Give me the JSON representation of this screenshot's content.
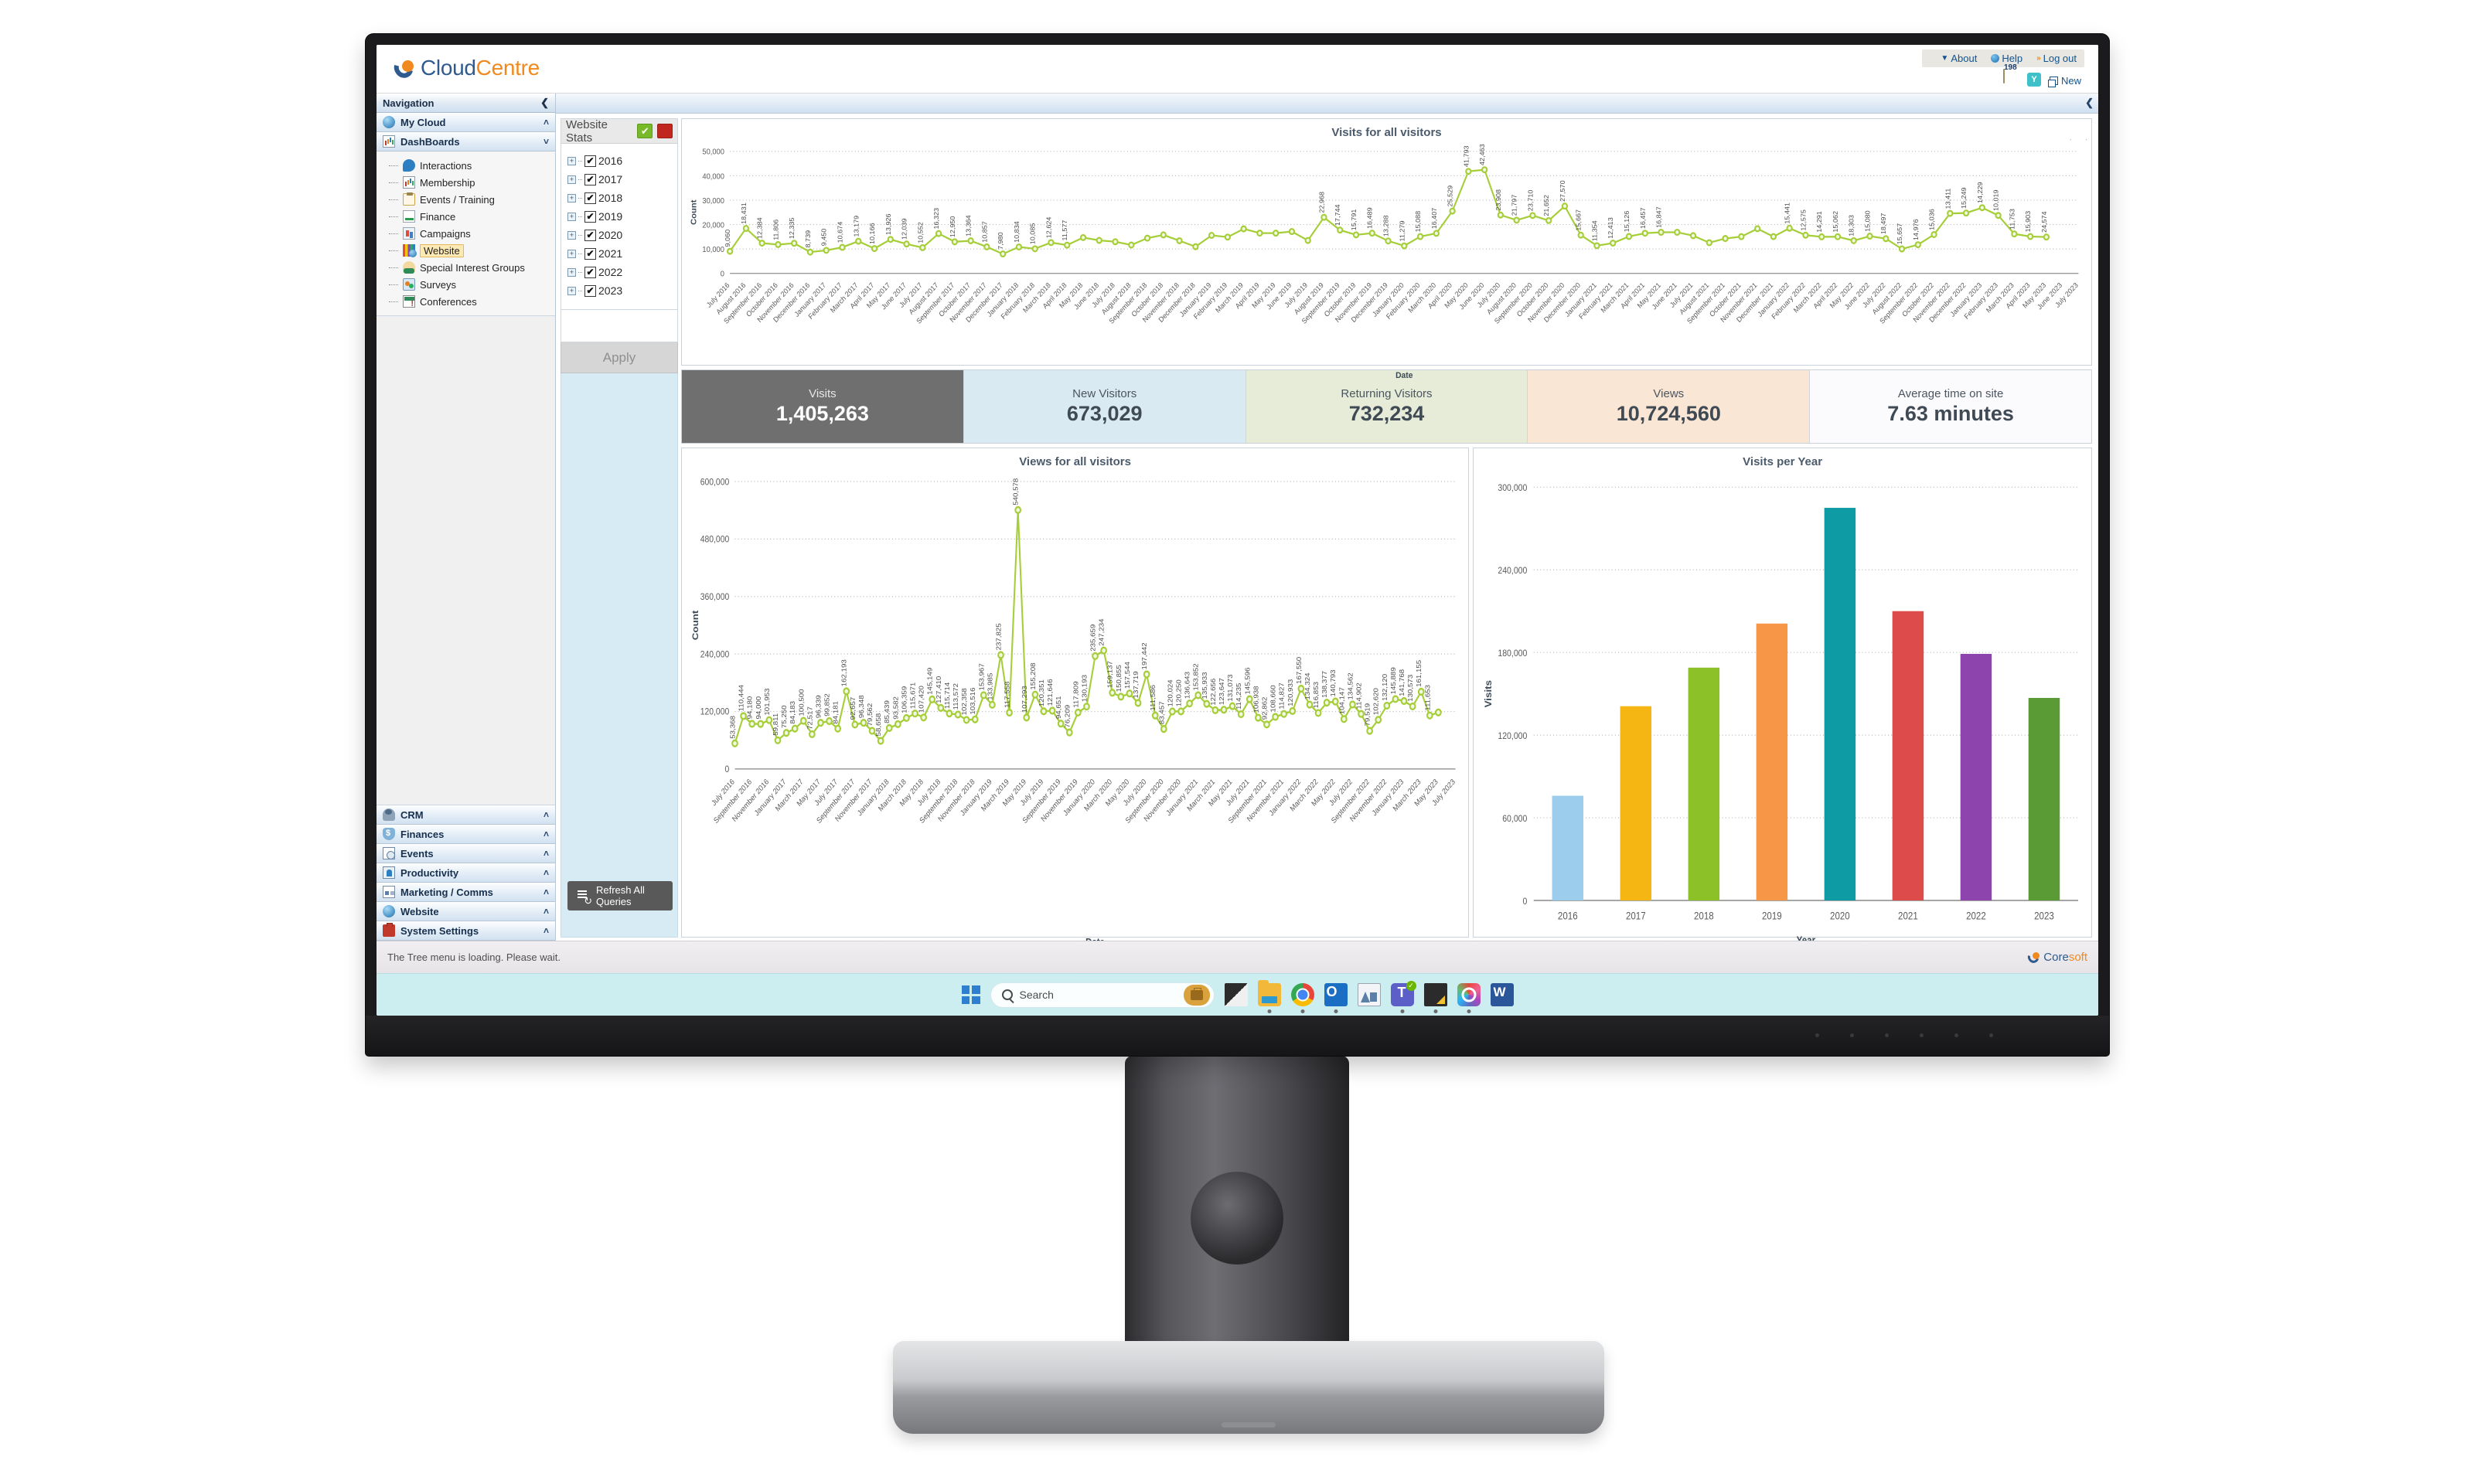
{
  "app": {
    "brand_first": "Cloud",
    "brand_second": "Centre",
    "status_text": "The Tree menu is loading. Please wait.",
    "footer_brand_first": "Core",
    "footer_brand_second": "soft"
  },
  "header": {
    "links": [
      {
        "label": "About",
        "icon": "caret-down-icon"
      },
      {
        "label": "Help",
        "icon": "globe-icon"
      },
      {
        "label": "Log out",
        "icon": "double-chevron-icon"
      }
    ],
    "note_badge": "198",
    "teal_icon_label": "Y",
    "new_label": "New"
  },
  "sidebar": {
    "nav_title": "Navigation",
    "sections_top": [
      {
        "label": "My Cloud",
        "icon": "cloud-icon",
        "chevron": "˄"
      },
      {
        "label": "DashBoards",
        "icon": "bar-chart-icon",
        "chevron": "˅"
      }
    ],
    "tree_items": [
      {
        "label": "Interactions",
        "icon": "chat-bubble-icon",
        "selected": false
      },
      {
        "label": "Membership",
        "icon": "bar-chart-icon",
        "selected": false
      },
      {
        "label": "Events / Training",
        "icon": "clipboard-icon",
        "selected": false
      },
      {
        "label": "Finance",
        "icon": "document-icon",
        "selected": false
      },
      {
        "label": "Campaigns",
        "icon": "campaign-chart-icon",
        "selected": false
      },
      {
        "label": "Website",
        "icon": "website-chart-icon",
        "selected": true
      },
      {
        "label": "Special Interest Groups",
        "icon": "people-group-icon",
        "selected": false
      },
      {
        "label": "Surveys",
        "icon": "survey-icon",
        "selected": false
      },
      {
        "label": "Conferences",
        "icon": "conference-icon",
        "selected": false
      }
    ],
    "sections_bottom": [
      {
        "label": "CRM",
        "icon": "person-icon",
        "chevron": "˄"
      },
      {
        "label": "Finances",
        "icon": "money-bag-icon",
        "chevron": "˄"
      },
      {
        "label": "Events",
        "icon": "calendar-clock-icon",
        "chevron": "˄"
      },
      {
        "label": "Productivity",
        "icon": "contact-card-icon",
        "chevron": "˄"
      },
      {
        "label": "Marketing / Comms",
        "icon": "newsletter-icon",
        "chevron": "˄"
      },
      {
        "label": "Website",
        "icon": "globe-icon",
        "chevron": "˄"
      },
      {
        "label": "System Settings",
        "icon": "toolbox-icon",
        "chevron": "˄"
      }
    ]
  },
  "filters": {
    "title": "Website Stats",
    "accept_icon": "check-icon",
    "accept_color": "#78b929",
    "cancel_color": "#c0281f",
    "years": [
      {
        "label": "2016",
        "checked": true
      },
      {
        "label": "2017",
        "checked": true
      },
      {
        "label": "2018",
        "checked": true
      },
      {
        "label": "2019",
        "checked": true
      },
      {
        "label": "2020",
        "checked": true
      },
      {
        "label": "2021",
        "checked": true
      },
      {
        "label": "2022",
        "checked": true
      },
      {
        "label": "2023",
        "checked": true
      }
    ],
    "apply_label": "Apply",
    "refresh_label": "Refresh All Queries"
  },
  "kpis": [
    {
      "label": "Visits",
      "value": "1,405,263",
      "bg": "#706f6f"
    },
    {
      "label": "New Visitors",
      "value": "673,029",
      "bg": "#daeaf3"
    },
    {
      "label": "Returning Visitors",
      "value": "732,234",
      "bg": "#e6ecd8"
    },
    {
      "label": "Views",
      "value": "10,724,560",
      "bg": "#fae6d4"
    },
    {
      "label": "Average time on site",
      "value": "7.63 minutes",
      "bg": "#fbfbfd"
    }
  ],
  "chart_data": [
    {
      "type": "line",
      "title": "Visits for all visitors",
      "xlabel": "Date",
      "ylabel": "Count",
      "ylim": [
        0,
        50000
      ],
      "yticks": [
        0,
        10000,
        20000,
        30000,
        40000,
        50000
      ],
      "ytick_labels": [
        "0",
        "10,000",
        "20,000",
        "30,000",
        "40,000",
        "50,000"
      ],
      "grid": true,
      "series_color": "#a6ce39",
      "x": [
        "July 2016",
        "August 2016",
        "September 2016",
        "October 2016",
        "November 2016",
        "December 2016",
        "January 2017",
        "February 2017",
        "March 2017",
        "April 2017",
        "May 2017",
        "June 2017",
        "July 2017",
        "August 2017",
        "September 2017",
        "October 2017",
        "November 2017",
        "December 2017",
        "January 2018",
        "February 2018",
        "March 2018",
        "April 2018",
        "May 2018",
        "June 2018",
        "July 2018",
        "August 2018",
        "September 2018",
        "October 2018",
        "November 2018",
        "December 2018",
        "January 2019",
        "February 2019",
        "March 2019",
        "April 2019",
        "May 2019",
        "June 2019",
        "July 2019",
        "August 2019",
        "September 2019",
        "October 2019",
        "November 2019",
        "December 2019",
        "January 2020",
        "February 2020",
        "March 2020",
        "April 2020",
        "May 2020",
        "June 2020",
        "July 2020",
        "August 2020",
        "September 2020",
        "October 2020",
        "November 2020",
        "December 2020",
        "January 2021",
        "February 2021",
        "March 2021",
        "April 2021",
        "May 2021",
        "June 2021",
        "July 2021",
        "August 2021",
        "September 2021",
        "October 2021",
        "November 2021",
        "December 2021",
        "January 2022",
        "February 2022",
        "March 2022",
        "April 2022",
        "May 2022",
        "June 2022",
        "July 2022",
        "August 2022",
        "September 2022",
        "October 2022",
        "November 2022",
        "December 2022",
        "January 2023",
        "February 2023",
        "March 2023",
        "April 2023",
        "May 2023",
        "June 2023",
        "July 2023"
      ],
      "values": [
        9060,
        18431,
        12384,
        11806,
        12335,
        8739,
        9450,
        10674,
        13179,
        10166,
        13926,
        12039,
        10552,
        16323,
        12950,
        13364,
        10857,
        7980,
        10834,
        10085,
        12624,
        11577,
        14685,
        13521,
        12961,
        11626,
        14442,
        15776,
        13378,
        10933,
        15579,
        14881,
        18249,
        16495,
        16487,
        17144,
        13492,
        22968,
        17744,
        15791,
        16489,
        13288,
        11279,
        15088,
        16407,
        25529,
        41793,
        42463,
        23908,
        21797,
        23710,
        21652,
        27570,
        15667,
        11354,
        12413,
        15126,
        16457,
        16847,
        16843,
        15441,
        12575,
        14291,
        15062,
        18303,
        15080,
        18497,
        15657,
        14976,
        15036,
        13411,
        15249,
        14229,
        10019,
        11753,
        15903,
        24574,
        24719,
        26912,
        23751,
        16164,
        15100,
        14900
      ],
      "labeled_points": {
        "July 2016": "9,060",
        "August 2016": "18,431",
        "September 2016": "12,384",
        "October 2016": "11,806",
        "November 2016": "12,335",
        "December 2016": "8,739",
        "January 2017": "9,450",
        "February 2017": "10,674",
        "March 2017": "13,179",
        "April 2017": "10,166",
        "May 2017": "13,926",
        "June 2017": "12,039",
        "July 2017": "10,552",
        "August 2017": "16,323",
        "September 2017": "12,950",
        "October 2017": "13,364",
        "November 2017": "10,857",
        "December 2017": "7,980",
        "January 2018": "10,834",
        "February 2018": "10,085",
        "March 2018": "12,624",
        "April 2018": "11,577",
        "August 2019": "22,968",
        "September 2019": "17,744",
        "October 2019": "15,791",
        "November 2019": "16,489",
        "December 2019": "13,288",
        "January 2020": "11,279",
        "February 2020": "15,088",
        "March 2020": "16,407",
        "April 2020": "25,529",
        "May 2020": "41,793",
        "June 2020": "42,463",
        "July 2020": "23,908",
        "August 2020": "21,797",
        "September 2020": "23,710",
        "October 2020": "21,652",
        "November 2020": "27,570",
        "December 2020": "15,667",
        "January 2021": "11,354",
        "February 2021": "12,413",
        "March 2021": "15,126",
        "April 2021": "16,457",
        "May 2021": "16,847",
        "January 2022": "15,441",
        "February 2022": "12,575",
        "March 2022": "14,291",
        "April 2022": "15,062",
        "May 2022": "18,303",
        "June 2022": "15,080",
        "July 2022": "18,497",
        "August 2022": "15,657",
        "September 2022": "14,976",
        "October 2022": "15,036",
        "November 2022": "13,411",
        "December 2022": "15,249",
        "January 2023": "14,229",
        "February 2023": "10,019",
        "March 2023": "11,753",
        "April 2023": "15,903",
        "May 2023": "24,574",
        "June 2023": "24,719",
        "July 2023": "26,912"
      }
    },
    {
      "type": "line",
      "title": "Views for all visitors",
      "xlabel": "Date",
      "ylabel": "Count",
      "ylim": [
        0,
        600000
      ],
      "yticks": [
        0,
        120000,
        240000,
        360000,
        480000,
        600000
      ],
      "ytick_labels": [
        "0",
        "120,000",
        "240,000",
        "360,000",
        "480,000",
        "600,000"
      ],
      "grid": true,
      "series_color": "#a6ce39",
      "x": [
        "July 2016",
        "August 2016",
        "September 2016",
        "October 2016",
        "November 2016",
        "December 2016",
        "January 2017",
        "February 2017",
        "March 2017",
        "April 2017",
        "May 2017",
        "June 2017",
        "July 2017",
        "August 2017",
        "September 2017",
        "October 2017",
        "November 2017",
        "December 2017",
        "January 2018",
        "February 2018",
        "March 2018",
        "April 2018",
        "May 2018",
        "June 2018",
        "July 2018",
        "August 2018",
        "September 2018",
        "October 2018",
        "November 2018",
        "December 2018",
        "January 2019",
        "February 2019",
        "March 2019",
        "April 2019",
        "May 2019",
        "June 2019",
        "July 2019",
        "August 2019",
        "September 2019",
        "October 2019",
        "November 2019",
        "December 2019",
        "January 2020",
        "February 2020",
        "March 2020",
        "April 2020",
        "May 2020",
        "June 2020",
        "July 2020",
        "August 2020",
        "September 2020",
        "October 2020",
        "November 2020",
        "December 2020",
        "January 2021",
        "February 2021",
        "March 2021",
        "April 2021",
        "May 2021",
        "June 2021",
        "July 2021",
        "August 2021",
        "September 2021",
        "October 2021",
        "November 2021",
        "December 2021",
        "January 2022",
        "February 2022",
        "March 2022",
        "April 2022",
        "May 2022",
        "June 2022",
        "July 2022",
        "August 2022",
        "September 2022",
        "October 2022",
        "November 2022",
        "December 2022",
        "January 2023",
        "February 2023",
        "March 2023",
        "April 2023",
        "May 2023",
        "June 2023",
        "July 2023"
      ],
      "values": [
        53368,
        110444,
        94180,
        94000,
        101953,
        59811,
        75250,
        84183,
        100500,
        72517,
        96339,
        99852,
        84181,
        162193,
        92657,
        96348,
        79562,
        58658,
        85439,
        93582,
        106359,
        115671,
        107420,
        145149,
        127410,
        115714,
        113572,
        102358,
        103516,
        153967,
        133985,
        237825,
        117558,
        540578,
        107293,
        155208,
        120351,
        121646,
        94651,
        76209,
        117809,
        130193,
        235659,
        247234,
        159137,
        150855,
        157544,
        137719,
        197442,
        111586,
        83457,
        120024,
        120250,
        136643,
        153852,
        135933,
        122656,
        123647,
        131073,
        114235,
        145596,
        106938,
        92862,
        108660,
        114827,
        120933,
        167550,
        134324,
        116853,
        138377,
        140793,
        104147,
        134562,
        114902,
        79519,
        102620,
        132120,
        145889,
        141768,
        130573,
        161155,
        111653,
        118000
      ],
      "labeled_points": {
        "July 2016": "53,368",
        "August 2016": "110,444",
        "September 2016": "94,180",
        "October 2016": "94,000",
        "November 2016": "101,953",
        "December 2016": "59,811",
        "January 2017": "75,250",
        "February 2017": "84,183",
        "March 2017": "100,500",
        "April 2017": "72,517",
        "May 2017": "96,339",
        "June 2017": "99,852",
        "July 2017": "84,181",
        "August 2017": "162,193",
        "September 2017": "92,657",
        "October 2017": "96,348",
        "November 2017": "79,562",
        "December 2017": "58,658",
        "January 2018": "85,439",
        "February 2018": "93,582",
        "March 2018": "106,359",
        "April 2018": "115,671",
        "May 2018": "107,420",
        "June 2018": "145,149",
        "July 2018": "127,410",
        "August 2018": "115,714",
        "September 2018": "113,572",
        "October 2018": "102,358",
        "November 2018": "103,516",
        "December 2018": "153,967",
        "January 2019": "133,985",
        "February 2019": "237,825",
        "March 2019": "117,558",
        "April 2019": "540,578",
        "May 2019": "107,293",
        "June 2019": "155,208",
        "July 2019": "120,351",
        "August 2019": "121,646",
        "September 2019": "94,651",
        "October 2019": "76,209",
        "November 2019": "117,809",
        "December 2019": "130,193",
        "January 2020": "235,659",
        "February 2020": "247,234",
        "March 2020": "159,137",
        "April 2020": "150,855",
        "May 2020": "157,544",
        "June 2020": "137,719",
        "July 2020": "197,442",
        "August 2020": "111,586",
        "September 2020": "83,457",
        "October 2020": "120,024",
        "November 2020": "120,250",
        "December 2020": "136,643",
        "January 2021": "153,852",
        "February 2021": "135,933",
        "March 2021": "122,656",
        "April 2021": "123,647",
        "May 2021": "131,073",
        "June 2021": "114,235",
        "July 2021": "145,596",
        "August 2021": "106,938",
        "September 2021": "92,862",
        "October 2021": "108,660",
        "November 2021": "114,827",
        "December 2021": "120,933",
        "January 2022": "167,550",
        "February 2022": "134,324",
        "March 2022": "116,853",
        "April 2022": "138,377",
        "May 2022": "140,793",
        "June 2022": "104,147",
        "July 2022": "134,562",
        "August 2022": "114,902",
        "September 2022": "79,519",
        "October 2022": "102,620",
        "November 2022": "132,120",
        "December 2022": "145,889",
        "January 2023": "141,768",
        "February 2023": "130,573",
        "March 2023": "161,155",
        "April 2023": "111,653"
      }
    },
    {
      "type": "bar",
      "title": "Visits per Year",
      "xlabel": "Year",
      "ylabel": "Visits",
      "ylim": [
        0,
        300000
      ],
      "yticks": [
        0,
        60000,
        120000,
        180000,
        240000,
        300000
      ],
      "ytick_labels": [
        "0",
        "60,000",
        "120,000",
        "180,000",
        "240,000",
        "300,000"
      ],
      "grid": true,
      "categories": [
        "2016",
        "2017",
        "2018",
        "2019",
        "2020",
        "2021",
        "2022",
        "2023"
      ],
      "values": [
        76000,
        141000,
        169000,
        201000,
        285000,
        210000,
        179000,
        147000
      ],
      "colors": [
        "#9ccdec",
        "#f5b512",
        "#8cc227",
        "#f79646",
        "#0f9ba3",
        "#dd4b4b",
        "#8e44ad",
        "#5b9b35"
      ]
    }
  ],
  "taskbar": {
    "search_placeholder": "Search",
    "apps": [
      {
        "name": "start-button",
        "icon": "windows-icon"
      },
      {
        "name": "file-explorer-dark",
        "icon": "app-icon"
      },
      {
        "name": "file-explorer",
        "icon": "folder-icon"
      },
      {
        "name": "chrome",
        "icon": "chrome-icon"
      },
      {
        "name": "outlook",
        "icon": "outlook-icon"
      },
      {
        "name": "analytics",
        "icon": "graph-icon"
      },
      {
        "name": "teams",
        "icon": "teams-icon"
      },
      {
        "name": "onenote",
        "icon": "onenote-icon"
      },
      {
        "name": "creative-cloud",
        "icon": "creative-cloud-icon"
      },
      {
        "name": "word",
        "icon": "word-icon"
      }
    ]
  }
}
